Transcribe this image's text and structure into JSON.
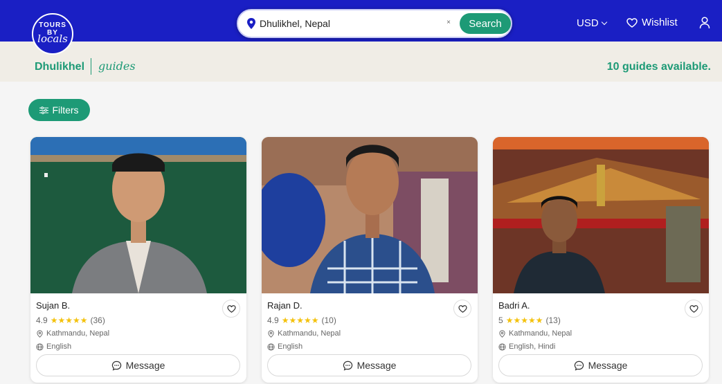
{
  "header": {
    "logo_top": "TOURS BY",
    "logo_bottom": "locals",
    "search_value": "Dhulikhel, Nepal",
    "search_clear": "×",
    "search_button": "Search",
    "currency": "USD",
    "wishlist": "Wishlist",
    "colors": {
      "brand": "#1a1fc4",
      "accent": "#1d9a76"
    }
  },
  "subheader": {
    "city": "Dhulikhel",
    "guides_word": "guides",
    "available": "10 guides available."
  },
  "filters": {
    "label": "Filters"
  },
  "guides": [
    {
      "name": "Sujan B.",
      "rating": "4.9",
      "stars": "★★★★★",
      "reviews": "(36)",
      "location": "Kathmandu, Nepal",
      "languages": "English",
      "message": "Message"
    },
    {
      "name": "Rajan D.",
      "rating": "4.9",
      "stars": "★★★★★",
      "reviews": "(10)",
      "location": "Kathmandu, Nepal",
      "languages": "English",
      "message": "Message"
    },
    {
      "name": "Badri A.",
      "rating": "5",
      "stars": "★★★★★",
      "reviews": "(13)",
      "location": "Kathmandu, Nepal",
      "languages": "English, Hindi",
      "message": "Message"
    }
  ]
}
